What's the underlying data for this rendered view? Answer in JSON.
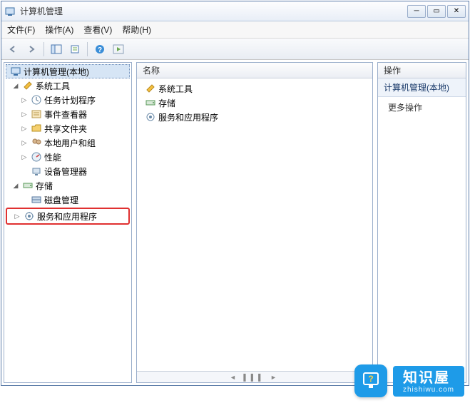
{
  "titlebar": {
    "title": "计算机管理"
  },
  "menubar": {
    "file": "文件(F)",
    "action": "操作(A)",
    "view": "查看(V)",
    "help": "帮助(H)"
  },
  "tree": {
    "root": "计算机管理(本地)",
    "system_tools": "系统工具",
    "task_scheduler": "任务计划程序",
    "event_viewer": "事件查看器",
    "shared_folders": "共享文件夹",
    "local_users": "本地用户和组",
    "performance": "性能",
    "device_manager": "设备管理器",
    "storage": "存储",
    "disk_management": "磁盘管理",
    "services_apps": "服务和应用程序"
  },
  "mid": {
    "header": "名称",
    "items": {
      "system_tools": "系统工具",
      "storage": "存储",
      "services_apps": "服务和应用程序"
    }
  },
  "right": {
    "header": "操作",
    "section": "计算机管理(本地)",
    "more": "更多操作"
  },
  "watermark": {
    "brand": "知识屋",
    "url": "zhishiwu.com"
  }
}
